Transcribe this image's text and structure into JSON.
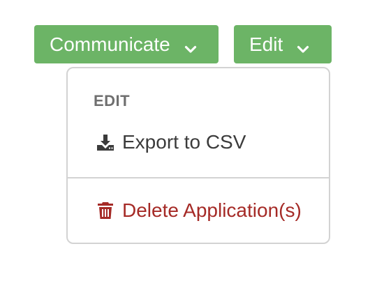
{
  "toolbar": {
    "communicate_label": "Communicate",
    "edit_label": "Edit",
    "button_color": "#6cb466"
  },
  "dropdown": {
    "section_header": "EDIT",
    "items": [
      {
        "label": "Export to CSV",
        "icon": "download-icon",
        "color": "#3b3b3b"
      },
      {
        "label": "Delete Application(s)",
        "icon": "trash-icon",
        "color": "#a52a26"
      }
    ]
  }
}
